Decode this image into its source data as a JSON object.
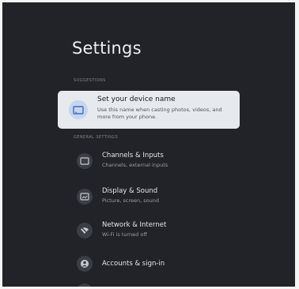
{
  "header": {
    "title": "Settings"
  },
  "sections": {
    "suggested": "Suggestions",
    "general": "General settings"
  },
  "suggestion_card": {
    "title": "Set your device name",
    "description": "Use this name when casting photos, videos, and more from your phone.",
    "icon": "tv-cast-icon"
  },
  "items": [
    {
      "title": "Channels & Inputs",
      "subtitle": "Channels, external inputs",
      "icon": "input-icon"
    },
    {
      "title": "Display & Sound",
      "subtitle": "Picture, screen, sound",
      "icon": "display-icon"
    },
    {
      "title": "Network & Internet",
      "subtitle": "Wi-Fi is turned off",
      "icon": "wifi-off-icon"
    },
    {
      "title": "Accounts & sign-in",
      "subtitle": "",
      "icon": "account-icon"
    }
  ],
  "colors": {
    "background": "#212328",
    "card": "#e6e9ee",
    "accent": "#c6d5ee"
  }
}
